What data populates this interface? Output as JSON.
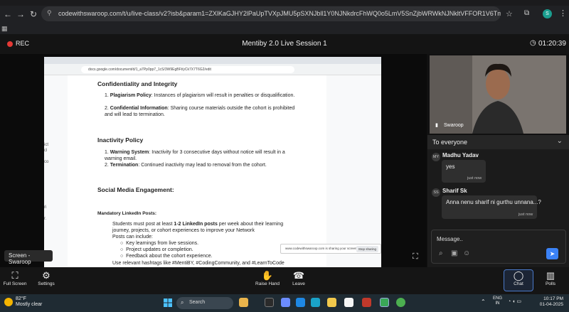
{
  "browser": {
    "url": "codewithswaroop.com/t/u/live-class/v2?isb&param1=ZXlKaGJHY2lPaUpTVXpJMU5pSXNJbll1Y0NJNkdrcFhWQ0o5LmV5SnZjbWRWkNJNkltVFFOR1V6Tmpoa0xXVXdPVFl0TkdWaU5DMDRPVG...",
    "profile_initial": "S"
  },
  "meeting": {
    "rec_label": "REC",
    "title": "Mentiby 2.0 Live Session 1",
    "timer": "01:20:39"
  },
  "shared_doc": {
    "url": "docs.google.com/document/d/1_a7Pp0pp7_1cS/3W9EgBFt/yCk7X7T6G2/edit",
    "left_panel": [
      "ict",
      "cl",
      "co",
      "ri",
      "r."
    ],
    "sections": {
      "confidentiality": {
        "heading": "Confidentiality and Integrity",
        "items": [
          {
            "label": "Plagiarism Policy",
            "text": ": Instances of plagiarism will result in penalties or disqualification."
          },
          {
            "label": "Confidential Information",
            "text": ": Sharing course materials outside the cohort is prohibited and will lead to termination."
          }
        ]
      },
      "inactivity": {
        "heading": "Inactivity Policy",
        "items": [
          {
            "label": "Warning System",
            "text": ": Inactivity for 3 consecutive days without notice will result in a warning email."
          },
          {
            "label": "Termination",
            "text": ": Continued inactivity may lead to removal from the cohort."
          }
        ]
      },
      "social": {
        "heading": "Social Media Engagement:",
        "subheading": "Mandatory LinkedIn Posts:",
        "para_start": "Students must post at least ",
        "para_bold": "1-2 LinkedIn posts",
        "para_end": " per week about their learning journey, projects, or cohort experiences to improve your Network",
        "posts_can_include": "Posts can include:",
        "bullets": [
          "Key learnings from live sessions.",
          "Project updates or completion.",
          "Feedback about the cohort experience."
        ],
        "hashtags": "Use relevant hashtags like #MentiBY, #CodingCommunity, and #LearnToCode"
      }
    },
    "share_notice": "www.codewithswaroop.com is sharing your screen.",
    "stop_sharing": "Stop sharing"
  },
  "screen_label": "Screen - Swaroop",
  "video": {
    "name": "Swaroop"
  },
  "chat": {
    "to": "To everyone",
    "messages": [
      {
        "initials": "MY",
        "sender": "Madhu Yadav",
        "text": "yes",
        "time": "just now"
      },
      {
        "initials": "SS",
        "sender": "Sharif Sk",
        "text": "Anna nenu sharif ni gurthu unnana...?",
        "time": "just now"
      }
    ],
    "placeholder": "Message.."
  },
  "toolbar": {
    "fullscreen": "Full Screen",
    "settings": "Settings",
    "raise_hand": "Raise Hand",
    "leave": "Leave",
    "chat": "Chat",
    "polls": "Polls"
  },
  "taskbar": {
    "temp": "82°F",
    "weather": "Mostly clear",
    "search": "Search",
    "lang_top": "ENG",
    "lang_bottom": "IN",
    "time": "10:17 PM",
    "date": "01-04-2025"
  }
}
